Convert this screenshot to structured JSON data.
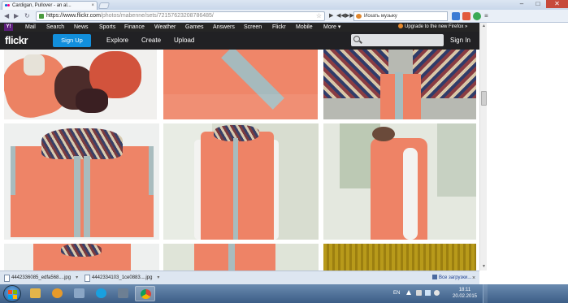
{
  "browser": {
    "tab_title": "Cardigan, Pullover - an al...",
    "url_main": "https://www.flickr.com",
    "url_rest": "/photos/mabenne/sets/72157623208786485/",
    "music_search_placeholder": "Искать музыку",
    "window_min": "–",
    "window_max": "□",
    "window_close": "✕"
  },
  "flickr_top": {
    "items": [
      "Mail",
      "Search",
      "News",
      "Sports",
      "Finance",
      "Weather",
      "Games",
      "Answers",
      "Screen",
      "Flickr",
      "Mobile",
      "More ▾"
    ],
    "upgrade_text": "Upgrade to the new Firefox »"
  },
  "flickr_nav": {
    "logo": "flickr",
    "signup": "Sign Up",
    "explore": "Explore",
    "create": "Create",
    "upload": "Upload",
    "signin": "Sign In"
  },
  "downloads": {
    "items": [
      {
        "name": "4442336085_edfa568....jpg"
      },
      {
        "name": "4442334103_1ce0883....jpg"
      }
    ],
    "all_downloads": "Все загрузки..."
  },
  "taskbar": {
    "lang": "EN",
    "time": "18:11",
    "date": "20.02.2015"
  },
  "colors": {
    "flickr_blue": "#128fdc",
    "flickr_dark": "#212124",
    "sweater_coral": "#ee8062",
    "trim_grey_blue": "#a6b9bd",
    "mustard": "#b89a1a"
  }
}
